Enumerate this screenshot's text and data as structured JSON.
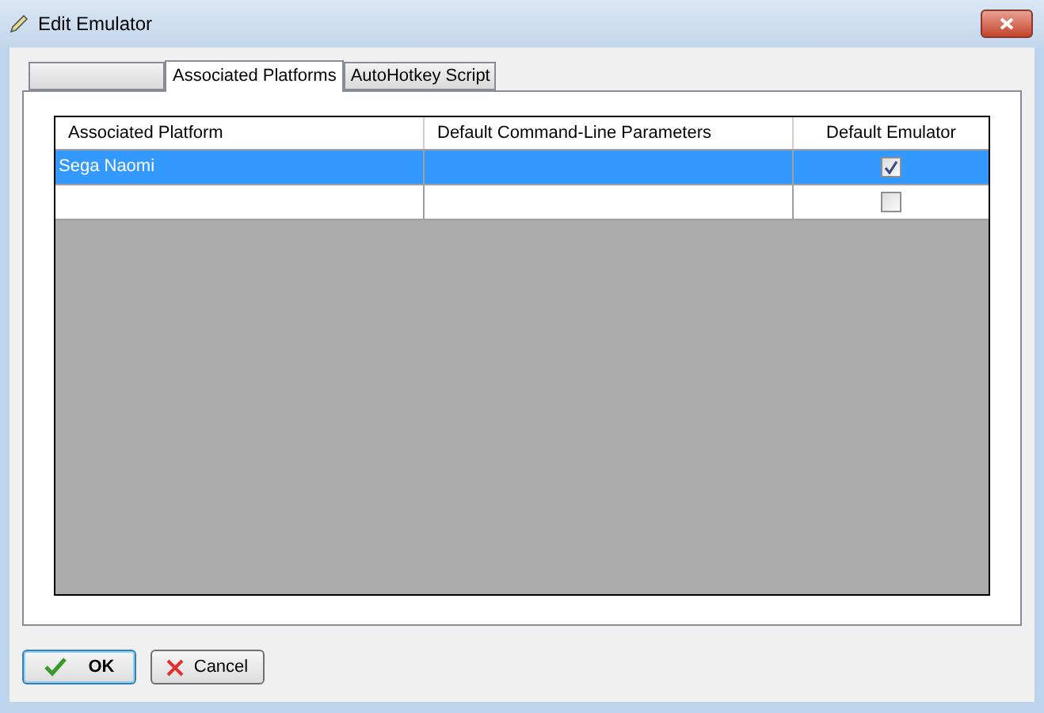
{
  "window": {
    "title": "Edit Emulator"
  },
  "tabs": [
    {
      "selected": false
    },
    {
      "label": "Associated Platforms",
      "selected": true
    },
    {
      "label": "AutoHotkey Script",
      "selected": false
    }
  ],
  "table": {
    "columns": [
      "Associated Platform",
      "Default Command-Line Parameters",
      "Default Emulator"
    ],
    "rows": [
      {
        "platform": "Sega Naomi",
        "selected": true,
        "default_emulator": true
      },
      {
        "selected": false,
        "default_emulator": false
      }
    ]
  },
  "buttons": [
    {
      "kind": "ok",
      "label": "OK",
      "focused": true
    },
    {
      "kind": "cancel",
      "label": "Cancel",
      "focused": false
    }
  ]
}
